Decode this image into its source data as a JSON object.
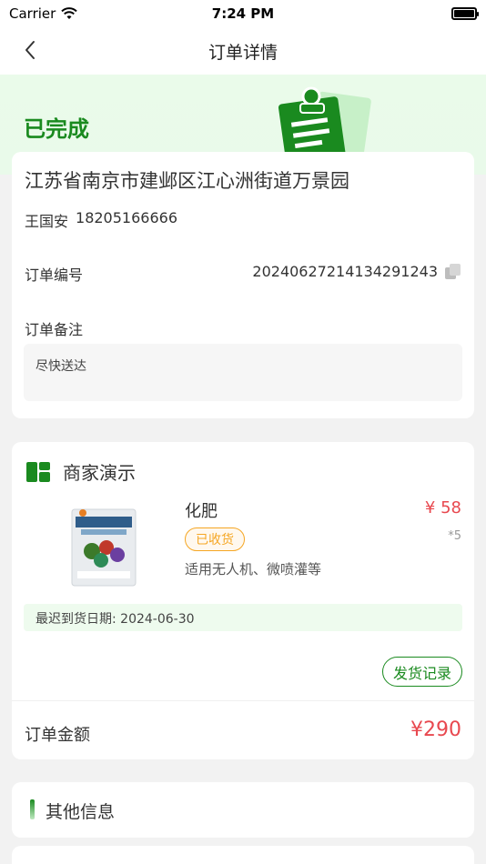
{
  "status_bar": {
    "carrier": "Carrier",
    "time": "7:24 PM"
  },
  "nav": {
    "title": "订单详情"
  },
  "hero": {
    "status": "已完成"
  },
  "address_card": {
    "address": "江苏省南京市建邺区江心洲街道万景园",
    "contact_name": "王国安",
    "contact_phone": "18205166666",
    "order_no_label": "订单编号",
    "order_no": "20240627214134291243",
    "remark_label": "订单备注",
    "remark": "尽快送达"
  },
  "goods_card": {
    "shop_name": "商家演示",
    "item": {
      "name": "化肥",
      "price": "¥ 58",
      "quantity": "*5",
      "status": "已收货",
      "description": "适用无人机、微喷灌等"
    },
    "delivery_date": "最迟到货日期: 2024-06-30",
    "ship_record_label": "发货记录",
    "total_label": "订单金额",
    "total_value": "¥290"
  },
  "other_card": {
    "title": "其他信息"
  },
  "colors": {
    "brand_green": "#1a8a1f",
    "price_red": "#e8484f",
    "status_orange": "#f5a623"
  }
}
